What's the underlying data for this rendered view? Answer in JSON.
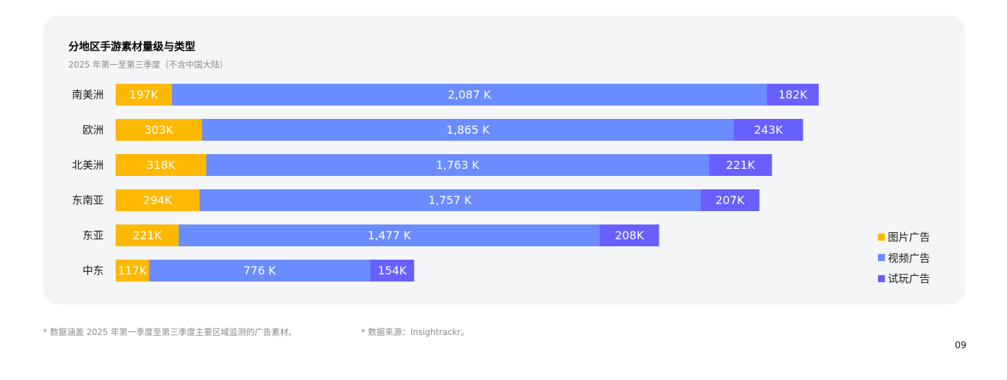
{
  "chart_data": {
    "type": "bar",
    "orientation": "horizontal",
    "stacked": true,
    "title": "分地区手游素材量级与类型",
    "subtitle": "2025 年第一至第三季度（不含中国大陆）",
    "categories": [
      "南美洲",
      "欧洲",
      "北美洲",
      "东南亚",
      "东亚",
      "中东"
    ],
    "series": [
      {
        "name": "图片广告",
        "color": "#ffb800",
        "values": [
          197,
          303,
          318,
          294,
          221,
          117
        ],
        "labels": [
          "197K",
          "303K",
          "318K",
          "294K",
          "221K",
          "117K"
        ]
      },
      {
        "name": "视频广告",
        "color": "#6b8cff",
        "values": [
          2087,
          1865,
          1763,
          1757,
          1477,
          776
        ],
        "labels": [
          "2,087 K",
          "1,865 K",
          "1,763 K",
          "1,757 K",
          "1,477 K",
          "776 K"
        ]
      },
      {
        "name": "试玩广告",
        "color": "#6760ff",
        "values": [
          182,
          243,
          221,
          207,
          208,
          154
        ],
        "labels": [
          "182K",
          "243K",
          "221K",
          "207K",
          "208K",
          "154K"
        ]
      }
    ],
    "grid": false,
    "legend_position": "bottom-right"
  },
  "footnotes": {
    "coverage": "* 数据涵盖 2025 年第一季度至第三季度主要区域监测的广告素材。",
    "source": "* 数据来源：Insightrackr。"
  },
  "page_number": "09"
}
